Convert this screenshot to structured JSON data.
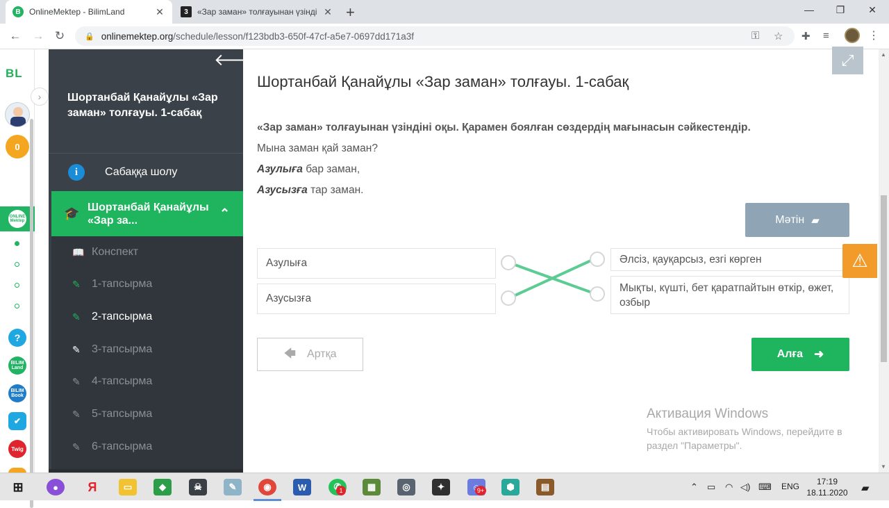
{
  "browser": {
    "tabs": [
      {
        "title": "OnlineMektep - BilimLand",
        "favicon": "B",
        "active": true
      },
      {
        "title": "«Зар заман» толғауынан үзінді",
        "favicon": "3",
        "active": false
      }
    ],
    "url_host": "onlinemektep.org",
    "url_path": "/schedule/lesson/f123bdb3-650f-47cf-a5e7-0697dd171a3f"
  },
  "rail": {
    "logo": "BL",
    "coins": "0",
    "online_label": "ONLINE Mektep",
    "apps": [
      {
        "label": "?",
        "color": "#1ea7e1"
      },
      {
        "label": "BILIM Land",
        "color": "#20b463"
      },
      {
        "label": "BILIM Book",
        "color": "#1e7cc8"
      },
      {
        "label": "✔",
        "color": "#1ea7e1"
      },
      {
        "label": "Twig",
        "color": "#e0232c"
      }
    ]
  },
  "sidebar": {
    "lesson_title": "Шортанбай Қанайұлы «Зар заман» толғауы. 1-сабақ",
    "overview": "Сабаққа шолу",
    "active_item": "Шортанбай Қанайұлы «Зар за...",
    "items": [
      {
        "label": "Конспект",
        "icon": "book-icon"
      },
      {
        "label": "1-тапсырма",
        "icon": "edit-icon"
      },
      {
        "label": "2-тапсырма",
        "icon": "edit-icon"
      },
      {
        "label": "3-тапсырма",
        "icon": "edit-icon"
      },
      {
        "label": "4-тапсырма",
        "icon": "edit-icon"
      },
      {
        "label": "5-тапсырма",
        "icon": "edit-icon"
      },
      {
        "label": "6-тапсырма",
        "icon": "edit-icon"
      }
    ]
  },
  "main": {
    "title": "Шортанбай Қанайұлы «Зар заман» толғауы. 1-сабақ",
    "instruction": "«Зар заман» толғауынан үзіндіні оқы. Қарамен боялған сөздердің мағынасын сәйкестендір.",
    "poem_line1": "Мына заман қай заман?",
    "poem_line2_bold": "Азулыға",
    "poem_line2_rest": " бар заман,",
    "poem_line3_bold": "Азусызға",
    "poem_line3_rest": " тар заман.",
    "text_button": "Мәтін",
    "left_items": [
      "Азулыға",
      "Азусызға"
    ],
    "right_items": [
      "Әлсіз, қауқарсыз, езгі көрген",
      "Мықты, күшті, бет қаратпайтын өткір, өжет, озбыр"
    ],
    "back_button": "Артқа",
    "next_button": "Алға"
  },
  "watermark": {
    "title": "Активация Windows",
    "text": "Чтобы активировать Windows, перейдите в раздел \"Параметры\"."
  },
  "taskbar": {
    "lang": "ENG",
    "time": "17:19",
    "date": "18.11.2020",
    "whatsapp_badge": "1",
    "discord_badge": "9+"
  },
  "colors": {
    "brand_green": "#1fb45e",
    "sidebar_dark": "#3b4148",
    "warning": "#f39b2a"
  }
}
